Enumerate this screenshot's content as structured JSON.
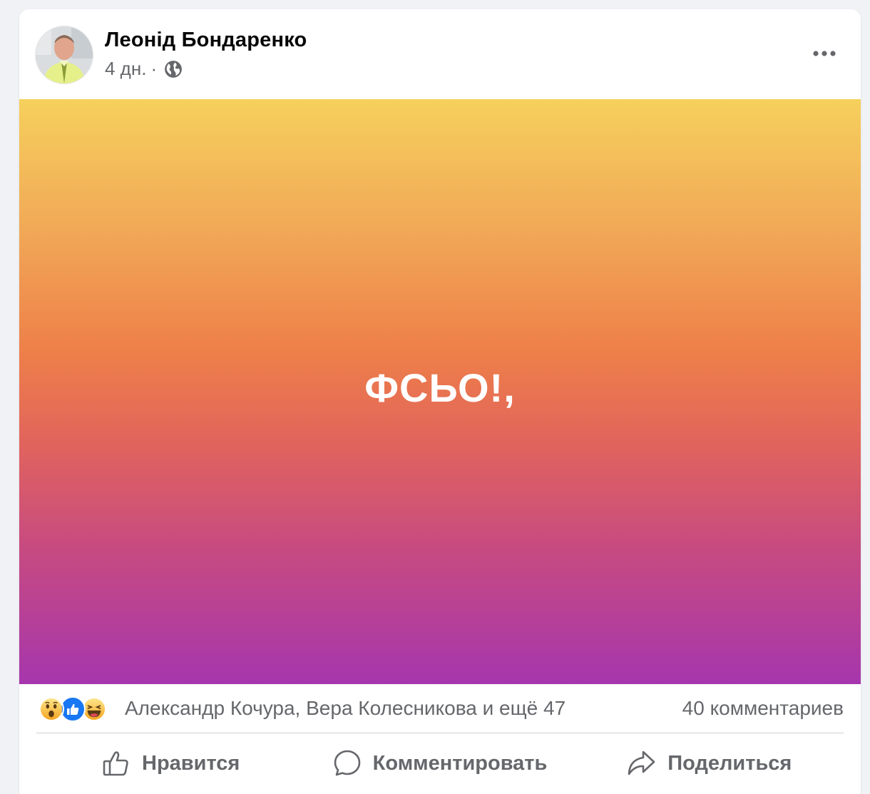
{
  "post": {
    "author": "Леонід Бондаренко",
    "time": "4 дн.",
    "separator": "·",
    "privacy_icon": "globe-icon",
    "menu_icon": "more-dots-icon",
    "text": "ФСЬО!,"
  },
  "reactions": {
    "icons": [
      "wow-reaction-icon",
      "like-reaction-icon",
      "haha-reaction-icon"
    ],
    "summary": "Александр Кочура, Вера Колесникова и ещё 47",
    "comments": "40 комментариев"
  },
  "actions": {
    "like_label": "Нравится",
    "comment_label": "Комментировать",
    "share_label": "Поделиться"
  },
  "colors": {
    "gradient_top": "#f6d05c",
    "gradient_mid": "#ee8049",
    "gradient_bottom": "#a636ad",
    "like_blue": "#1877f2",
    "secondary_text": "#65676b"
  }
}
